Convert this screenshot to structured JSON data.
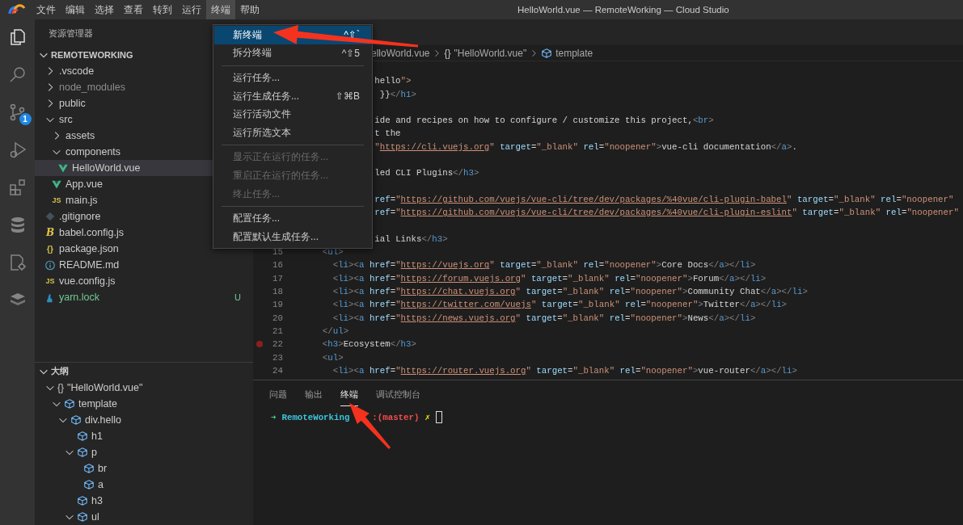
{
  "window": {
    "title": "HelloWorld.vue — RemoteWorking — Cloud Studio"
  },
  "menu_bar": [
    {
      "label": "文件",
      "selected": false
    },
    {
      "label": "编辑",
      "selected": false
    },
    {
      "label": "选择",
      "selected": false
    },
    {
      "label": "查看",
      "selected": false
    },
    {
      "label": "转到",
      "selected": false
    },
    {
      "label": "运行",
      "selected": false
    },
    {
      "label": "终端",
      "selected": true
    },
    {
      "label": "帮助",
      "selected": false
    }
  ],
  "terminal_menu": [
    {
      "kind": "item",
      "label": "新终端",
      "shortcut": "^⇧`",
      "selected": true,
      "disabled": false
    },
    {
      "kind": "item",
      "label": "拆分终端",
      "shortcut": "^⇧5",
      "selected": false,
      "disabled": false
    },
    {
      "kind": "separator"
    },
    {
      "kind": "item",
      "label": "运行任务...",
      "selected": false,
      "disabled": false
    },
    {
      "kind": "item",
      "label": "运行生成任务...",
      "shortcut": "⇧⌘B",
      "selected": false,
      "disabled": false
    },
    {
      "kind": "item",
      "label": "运行活动文件",
      "selected": false,
      "disabled": false
    },
    {
      "kind": "item",
      "label": "运行所选文本",
      "selected": false,
      "disabled": false
    },
    {
      "kind": "separator"
    },
    {
      "kind": "item",
      "label": "显示正在运行的任务...",
      "selected": false,
      "disabled": true
    },
    {
      "kind": "item",
      "label": "重启正在运行的任务...",
      "selected": false,
      "disabled": true
    },
    {
      "kind": "item",
      "label": "终止任务...",
      "selected": false,
      "disabled": true
    },
    {
      "kind": "separator"
    },
    {
      "kind": "item",
      "label": "配置任务...",
      "selected": false,
      "disabled": false
    },
    {
      "kind": "item",
      "label": "配置默认生成任务...",
      "selected": false,
      "disabled": false
    }
  ],
  "activity_bar": [
    {
      "kind": "explorer",
      "selected": true
    },
    {
      "kind": "search",
      "selected": false
    },
    {
      "kind": "source-control",
      "selected": false,
      "badge": "1"
    },
    {
      "kind": "run-debug",
      "selected": false
    },
    {
      "kind": "extensions",
      "selected": false
    },
    {
      "kind": "database",
      "selected": false
    },
    {
      "kind": "document-gear",
      "selected": false
    },
    {
      "kind": "layers",
      "selected": false
    }
  ],
  "explorer": {
    "title": "资源管理器",
    "root": {
      "label": "REMOTEWORKING",
      "expanded": true
    },
    "items": [
      {
        "label": ".vscode",
        "kind": "folder",
        "expanded": false,
        "selected": false,
        "ignored": false
      },
      {
        "label": "node_modules",
        "kind": "folder",
        "expanded": false,
        "selected": false,
        "ignored": true
      },
      {
        "label": "public",
        "kind": "folder",
        "expanded": false,
        "selected": false,
        "ignored": false
      },
      {
        "label": "src",
        "kind": "folder",
        "expanded": true,
        "selected": false,
        "ignored": false,
        "children": [
          {
            "label": "assets",
            "kind": "folder",
            "expanded": false,
            "selected": false,
            "ignored": false
          },
          {
            "label": "components",
            "kind": "folder",
            "expanded": true,
            "selected": false,
            "ignored": false,
            "children": [
              {
                "label": "HelloWorld.vue",
                "kind": "vue",
                "selected": true,
                "ignored": false
              }
            ]
          },
          {
            "label": "App.vue",
            "kind": "vue",
            "selected": false,
            "ignored": false
          },
          {
            "label": "main.js",
            "kind": "js",
            "icon_text": "JS",
            "selected": false,
            "ignored": false
          }
        ]
      },
      {
        "label": ".gitignore",
        "kind": "git",
        "selected": false,
        "ignored": false
      },
      {
        "label": "babel.config.js",
        "kind": "babel",
        "icon_text": "B",
        "selected": false,
        "ignored": false
      },
      {
        "label": "package.json",
        "kind": "json",
        "icon_text": "{}",
        "selected": false,
        "ignored": false
      },
      {
        "label": "README.md",
        "kind": "info",
        "selected": false,
        "ignored": false
      },
      {
        "label": "vue.config.js",
        "kind": "js",
        "icon_text": "JS",
        "selected": false,
        "ignored": false
      },
      {
        "label": "yarn.lock",
        "kind": "yarn",
        "selected": false,
        "ignored": false,
        "status": "U"
      }
    ]
  },
  "outline": {
    "title": "大纲",
    "expanded": true,
    "items": [
      {
        "label": "\"HelloWorld.vue\"",
        "kind": "module",
        "icon_text": "{}",
        "expanded": true,
        "children": [
          {
            "label": "template",
            "kind": "element",
            "expanded": true,
            "children": [
              {
                "label": "div.hello",
                "kind": "element",
                "expanded": true,
                "children": [
                  {
                    "label": "h1",
                    "kind": "element"
                  },
                  {
                    "label": "p",
                    "kind": "element",
                    "expanded": true,
                    "children": [
                      {
                        "label": "br",
                        "kind": "element"
                      },
                      {
                        "label": "a",
                        "kind": "element"
                      }
                    ]
                  },
                  {
                    "label": "h3",
                    "kind": "element"
                  },
                  {
                    "label": "ul",
                    "kind": "element",
                    "expanded": true
                  }
                ]
              }
            ]
          }
        ]
      }
    ]
  },
  "breadcrumb": [
    {
      "label": "elloWorld.vue",
      "kind": "file"
    },
    {
      "label": "\"HelloWorld.vue\"",
      "kind": "module",
      "icon_text": "{}"
    },
    {
      "label": "template",
      "kind": "element"
    }
  ],
  "code_lines": [
    {
      "kind": "hidden"
    },
    {
      "kind": "partial",
      "text": "hello\">"
    },
    {
      "kind": "partial",
      "text": " }}</h1>"
    },
    {
      "kind": "hidden"
    },
    {
      "kind": "partial",
      "text": "ide and recipes on how to configure / customize this project,<br>"
    },
    {
      "kind": "partial",
      "text": "t the"
    },
    {
      "kind": "partial",
      "text": "\"https://cli.vuejs.org\" target=\"_blank\" rel=\"noopener\">vue-cli documentation</a>."
    },
    {
      "kind": "hidden"
    },
    {
      "kind": "partial",
      "text": "led CLI Plugins</h3>"
    },
    {
      "kind": "hidden"
    },
    {
      "kind": "partial",
      "text": "ref=\"https://github.com/vuejs/vue-cli/tree/dev/packages/%40vue/cli-plugin-babel\" target=\"_blank\" rel=\"noopener\""
    },
    {
      "kind": "partial",
      "text": "ref=\"https://github.com/vuejs/vue-cli/tree/dev/packages/%40vue/cli-plugin-eslint\" target=\"_blank\" rel=\"noopener\""
    },
    {
      "kind": "hidden"
    },
    {
      "kind": "partial",
      "text": "ial Links</h3>"
    },
    {
      "kind": "full",
      "number": "15",
      "text": "    <ul>",
      "breakpoint": false
    },
    {
      "kind": "full",
      "number": "16",
      "text": "      <li><a href=\"https://vuejs.org\" target=\"_blank\" rel=\"noopener\">Core Docs</a></li>",
      "breakpoint": false
    },
    {
      "kind": "full",
      "number": "17",
      "text": "      <li><a href=\"https://forum.vuejs.org\" target=\"_blank\" rel=\"noopener\">Forum</a></li>",
      "breakpoint": false
    },
    {
      "kind": "full",
      "number": "18",
      "text": "      <li><a href=\"https://chat.vuejs.org\" target=\"_blank\" rel=\"noopener\">Community Chat</a></li>",
      "breakpoint": false
    },
    {
      "kind": "full",
      "number": "19",
      "text": "      <li><a href=\"https://twitter.com/vuejs\" target=\"_blank\" rel=\"noopener\">Twitter</a></li>",
      "breakpoint": false
    },
    {
      "kind": "full",
      "number": "20",
      "text": "      <li><a href=\"https://news.vuejs.org\" target=\"_blank\" rel=\"noopener\">News</a></li>",
      "breakpoint": false
    },
    {
      "kind": "full",
      "number": "21",
      "text": "    </ul>",
      "breakpoint": false
    },
    {
      "kind": "full",
      "number": "22",
      "text": "    <h3>Ecosystem</h3>",
      "breakpoint": true
    },
    {
      "kind": "full",
      "number": "23",
      "text": "    <ul>",
      "breakpoint": false
    },
    {
      "kind": "full",
      "number": "24",
      "text": "      <li><a href=\"https://router.vuejs.org\" target=\"_blank\" rel=\"noopener\">vue-router</a></li>",
      "breakpoint": false
    }
  ],
  "panel": {
    "tabs": [
      {
        "label": "问题",
        "selected": false
      },
      {
        "label": "输出",
        "selected": false
      },
      {
        "label": "终端",
        "selected": true
      },
      {
        "label": "调试控制台",
        "selected": false
      }
    ],
    "terminal": [
      {
        "kind": "arrow",
        "text": "➜"
      },
      {
        "kind": "directory",
        "text": "RemoteWorking"
      },
      {
        "kind": "branch",
        "text": ":(master)"
      },
      {
        "kind": "dirty",
        "text": "✗"
      }
    ]
  }
}
